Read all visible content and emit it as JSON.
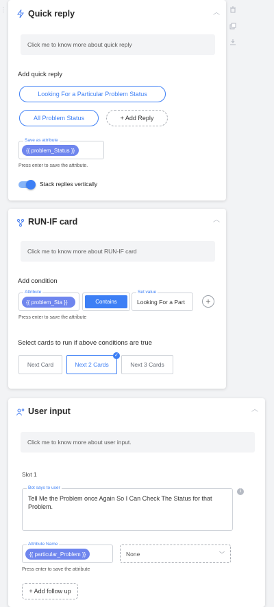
{
  "side_toolbar": {
    "left_icon": "drag-handle-icon",
    "icons": [
      "trash-icon",
      "copy-icon",
      "download-icon"
    ]
  },
  "quick_reply": {
    "title": "Quick reply",
    "icon": "lightning-icon",
    "info": "Click me to know more about quick reply",
    "add_label": "Add quick reply",
    "buttons": [
      "Looking For a Particular Problem Status",
      "All Problem Status"
    ],
    "add_button": "+ Add Reply",
    "save_attr_legend": "Save as attribute",
    "save_attr_chip": "{{ problem_Status }}",
    "hint": "Press enter to save the attribute.",
    "toggle_label": "Stack replies vertically",
    "toggle_on": true
  },
  "run_if": {
    "title": "RUN-IF card",
    "icon": "branch-icon",
    "info": "Click me to know more about RUN-IF card",
    "add_condition_label": "Add condition",
    "attribute_legend": "Attribute",
    "attribute_chip": "{{ problem_Sta }}",
    "operator": "Contains",
    "set_value_legend": "Set value",
    "set_value": "Looking For a Part",
    "hint": "Press enter to save the attribute",
    "select_label": "Select cards to run if above conditions are true",
    "options": [
      "Next Card",
      "Next 2 Cards",
      "Next 3 Cards"
    ],
    "selected_option": "Next 2 Cards"
  },
  "user_input": {
    "title": "User input",
    "icon": "user-input-icon",
    "info": "Click me to know more about user input.",
    "slot_label": "Slot 1",
    "bot_says_legend": "Bot says to user",
    "bot_says": "Tell Me the Problem once Again So I Can Check The Status for that Problem.",
    "attribute_legend": "Attribute Name",
    "attribute_chip": "{{ particular_Problem }}",
    "select_value": "None",
    "hint": "Press enter to save the attribute",
    "follow_up": "+ Add follow up"
  },
  "colors": {
    "accent": "#3d7ff5",
    "chip": "#6f86ee",
    "card_bg": "#ffffff",
    "page_bg": "#f2f3f5"
  }
}
